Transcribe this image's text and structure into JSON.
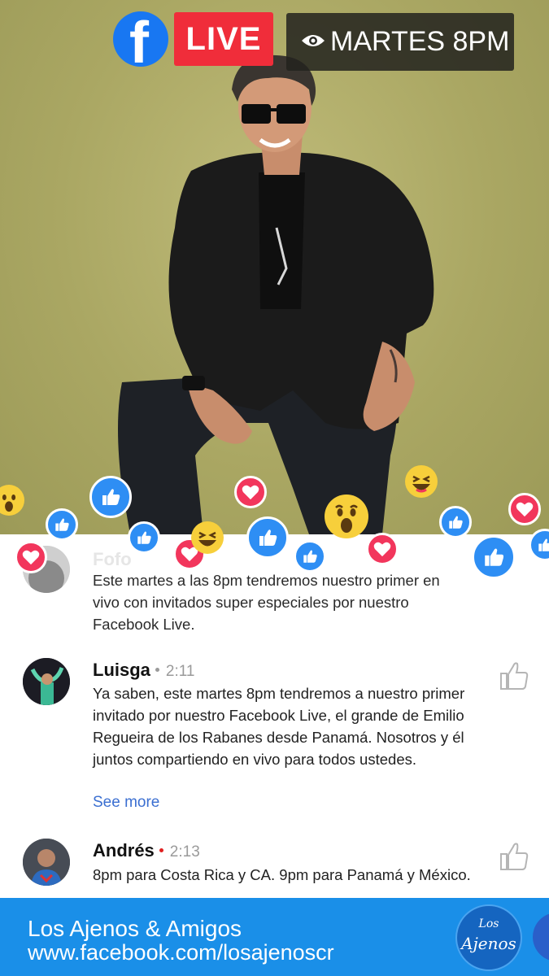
{
  "stream": {
    "platform_icon": "facebook-icon",
    "live_label": "LIVE",
    "schedule_label": "MARTES 8PM",
    "viewers_icon": "eye-icon"
  },
  "comments": [
    {
      "author": "Fofo",
      "time": "",
      "text": "Este martes a las 8pm tendremos nuestro primer en vivo con invitados super especiales por nuestro Facebook Live.",
      "see_more": ""
    },
    {
      "author": "Luisga",
      "time": "2:11",
      "text": "Ya saben, este martes 8pm tendremos a nuestro primer invitado por nuestro Facebook Live, el grande de Emilio Regueira de los Rabanes desde Panamá. Nosotros y él juntos compartiendo en vivo para todos ustedes.",
      "see_more": "See more"
    },
    {
      "author": "Andrés",
      "time": "2:13",
      "text": "8pm para Costa Rica y CA. 9pm para Panamá y México.",
      "see_more": ""
    }
  ],
  "reactions": [
    "like",
    "love",
    "haha",
    "wow"
  ],
  "footer": {
    "title": "Los Ajenos & Amigos",
    "url": "www.facebook.com/losajenoscr",
    "logo_text_top": "Los",
    "logo_text_main": "Ajenos"
  },
  "colors": {
    "facebook_blue": "#1877f2",
    "live_red": "#f02d3a",
    "footer_blue": "#1a8fe8",
    "link_blue": "#3b6fd1",
    "hero_background": "#aaa763"
  }
}
